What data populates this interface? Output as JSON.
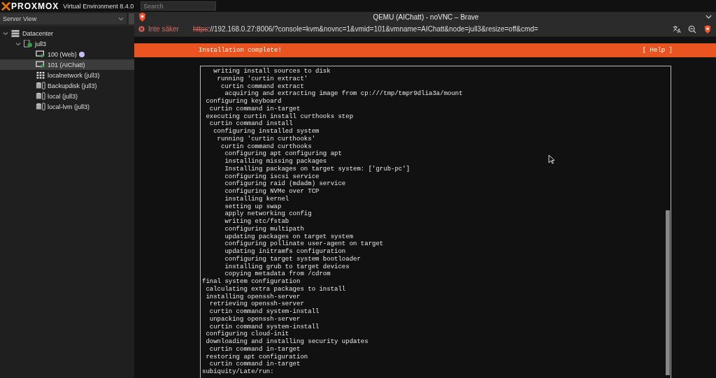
{
  "app": {
    "brand": "PROXMOX",
    "product": "Virtual Environment 8.4.0",
    "search": {
      "placeholder": "Search"
    }
  },
  "sidebar": {
    "view": "Server View",
    "tree": [
      {
        "label": "Datacenter",
        "kind": "datacenter",
        "selected": false,
        "expanded": true,
        "children": [
          {
            "label": "jull3",
            "kind": "node",
            "selected": false,
            "expanded": true,
            "children": [
              {
                "label": "100 (Web)",
                "kind": "vm",
                "selected": false,
                "color": "#c9b8f2"
              },
              {
                "label": "101 (AIChatt)",
                "kind": "vm",
                "selected": true
              },
              {
                "label": "localnetwork (jull3)",
                "kind": "network",
                "selected": false
              },
              {
                "label": "Backupdisk (jull3)",
                "kind": "storage",
                "selected": false
              },
              {
                "label": "local (jull3)",
                "kind": "storage",
                "selected": false
              },
              {
                "label": "local-lvm (jull3)",
                "kind": "storage",
                "selected": false
              }
            ]
          }
        ]
      }
    ]
  },
  "browser": {
    "title": "QEMU (AIChatt) - noVNC – Brave",
    "security": "Inte säker",
    "url_scheme": "https",
    "url_rest": "://192.168.0.27:8006/?console=kvm&novnc=1&vmid=101&vmname=AIChatt&node=jull3&resize=off&cmd="
  },
  "installer": {
    "header": "Installation complete!",
    "help": "[ Help ]",
    "log": [
      "   writing install sources to disk",
      "    running 'curtin extract'",
      "     curtin command extract",
      "      acquiring and extracting image from cp:///tmp/tmpr9dlia3a/mount",
      " configuring keyboard",
      "  curtin command in-target",
      " executing curtin install curthooks step",
      "  curtin command install",
      "   configuring installed system",
      "    running 'curtin curthooks'",
      "     curtin command curthooks",
      "      configuring apt configuring apt",
      "      installing missing packages",
      "      Installing packages on target system: ['grub-pc']",
      "      configuring iscsi service",
      "      configuring raid (mdadm) service",
      "      configuring NVMe over TCP",
      "      installing kernel",
      "      setting up swap",
      "      apply networking config",
      "      writing etc/fstab",
      "      configuring multipath",
      "      updating packages on target system",
      "      configuring pollinate user-agent on target",
      "      updating initramfs configuration",
      "      configuring target system bootloader",
      "      installing grub to target devices",
      "      copying metadata from /cdrom",
      "final system configuration",
      " calculating extra packages to install",
      " installing openssh-server",
      "  retrieving openssh-server",
      "  curtin command system-install",
      "  unpacking openssh-server",
      "  curtin command system-install",
      " configuring cloud-init",
      " downloading and installing security updates",
      "  curtin command in-target",
      " restoring apt configuration",
      "  curtin command in-target",
      "subiquity/Late/run:"
    ]
  }
}
